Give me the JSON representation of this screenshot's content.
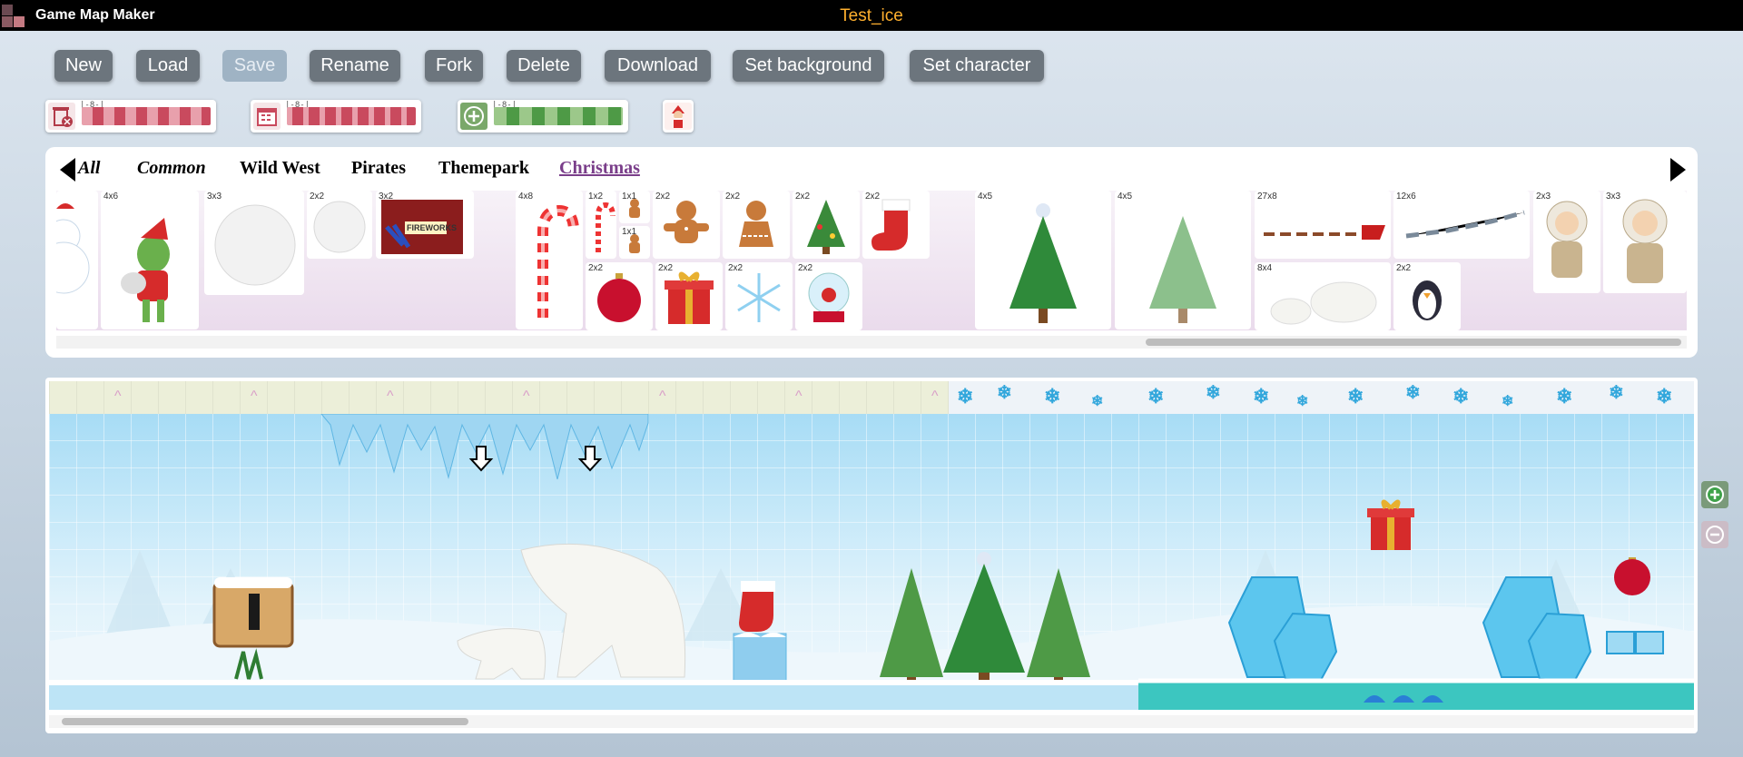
{
  "app": {
    "name": "Game Map Maker",
    "document_title": "Test_ice"
  },
  "toolbar": {
    "new": "New",
    "load": "Load",
    "save": "Save",
    "rename": "Rename",
    "fork": "Fork",
    "delete": "Delete",
    "download": "Download",
    "set_background": "Set background",
    "set_character": "Set character"
  },
  "palette_tools": {
    "eraser": {
      "icon": "trash-eraser-icon",
      "measure": "|-8-|"
    },
    "calendar": {
      "icon": "calendar-tile-icon",
      "measure": "|-8-|"
    },
    "add": {
      "icon": "plus-circle-icon",
      "measure": "|-8-|"
    },
    "character": {
      "icon": "santa-character-icon"
    }
  },
  "library": {
    "categories": [
      "All",
      "Common",
      "Wild West",
      "Pirates",
      "Themepark",
      "Christmas"
    ],
    "active_category": "Christmas",
    "items": [
      {
        "name": "snowman",
        "size": ""
      },
      {
        "name": "grinch",
        "size": "4x6"
      },
      {
        "name": "snowball-large",
        "size": "3x3"
      },
      {
        "name": "snowball-small",
        "size": "2x2"
      },
      {
        "name": "fireworks-crate",
        "size": "3x2",
        "label": "FIREWORKS"
      },
      {
        "name": "candy-cane-large",
        "size": "4x8"
      },
      {
        "name": "candy-cane-small",
        "size": "1x2"
      },
      {
        "name": "gingerbread-tiny",
        "size": "1x1"
      },
      {
        "name": "gingerbread-tiny-2",
        "size": "1x1"
      },
      {
        "name": "gingerbread-man",
        "size": "2x2"
      },
      {
        "name": "gingerbread-woman",
        "size": "2x2"
      },
      {
        "name": "mini-xmas-tree",
        "size": "2x2"
      },
      {
        "name": "stocking",
        "size": "2x2"
      },
      {
        "name": "ornament-red",
        "size": "2x2"
      },
      {
        "name": "gift-box",
        "size": "2x2"
      },
      {
        "name": "snowflake-ornament",
        "size": "2x2"
      },
      {
        "name": "snow-globe",
        "size": "2x2"
      },
      {
        "name": "xmas-tree-large",
        "size": "4x5"
      },
      {
        "name": "xmas-tree-faded",
        "size": "4x5"
      },
      {
        "name": "reindeer-sleigh",
        "size": "27x8"
      },
      {
        "name": "sleigh-silhouette",
        "size": "12x6"
      },
      {
        "name": "polar-bears",
        "size": "8x4"
      },
      {
        "name": "penguin",
        "size": "2x2"
      },
      {
        "name": "inuit-child",
        "size": "2x3"
      },
      {
        "name": "inuit-woman",
        "size": "3x3"
      }
    ]
  },
  "editor": {
    "background": "snowy-forest",
    "objects": [
      "icicles",
      "down-arrow",
      "down-arrow",
      "wooden-sign",
      "polar-bear-small",
      "polar-bear-large",
      "stocking",
      "ice-block",
      "xmas-tree",
      "xmas-tree",
      "xmas-tree",
      "gift-box",
      "ice-crystals",
      "ice-crystals",
      "ornament-red"
    ]
  },
  "side_controls": {
    "add_row": "plus-circle-icon",
    "remove_row": "minus-circle-icon"
  },
  "colors": {
    "title_accent": "#ffb02e",
    "button_bg": "#6c757d",
    "active_category": "#7a3e8a"
  }
}
